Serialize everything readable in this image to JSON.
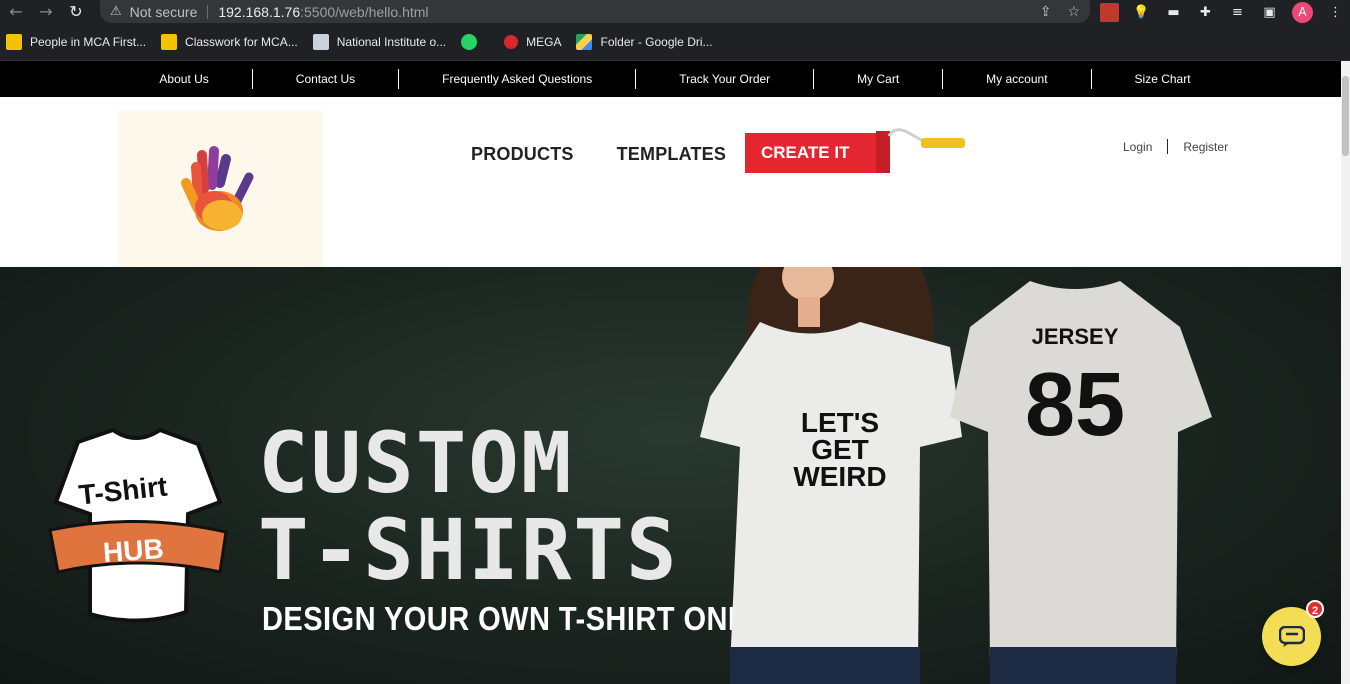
{
  "browser": {
    "security_label": "Not secure",
    "url_host": "192.168.1.76",
    "url_rest": ":5500/web/hello.html",
    "profile_initial": "A"
  },
  "bookmarks": [
    {
      "label": "People in MCA First...",
      "color": "#f3c300"
    },
    {
      "label": "Classwork for MCA...",
      "color": "#f3c300"
    },
    {
      "label": "National Institute o...",
      "color": "#c9d2dc"
    },
    {
      "label": "",
      "color": "#25d366"
    },
    {
      "label": "MEGA",
      "color": "#d9272e"
    },
    {
      "label": "Folder - Google Dri...",
      "color": "#1fa463"
    }
  ],
  "topnav": [
    "About Us",
    "Contact Us",
    "Frequently Asked Questions",
    "Track Your Order",
    "My Cart",
    "My account",
    "Size Chart"
  ],
  "header": {
    "nav": [
      "PRODUCTS",
      "TEMPLATES"
    ],
    "create_label": "CREATE IT",
    "login": "Login",
    "register": "Register"
  },
  "hero": {
    "badge_line1": "T-Shirt",
    "badge_line2": "HUB",
    "headline1": "CUSTOM",
    "headline2": "T-SHIRTS",
    "tagline": "DESIGN YOUR OWN T-SHIRT ONLINE",
    "shirt_female_text1": "LET'S",
    "shirt_female_text2": "GET",
    "shirt_female_text3": "WEIRD",
    "shirt_male_text": "JERSEY",
    "shirt_male_number": "85"
  },
  "chat": {
    "badge_count": "2"
  },
  "colors": {
    "accent": "#e3262f",
    "chat": "#f2dd55",
    "badge_orange": "#e0743f"
  }
}
